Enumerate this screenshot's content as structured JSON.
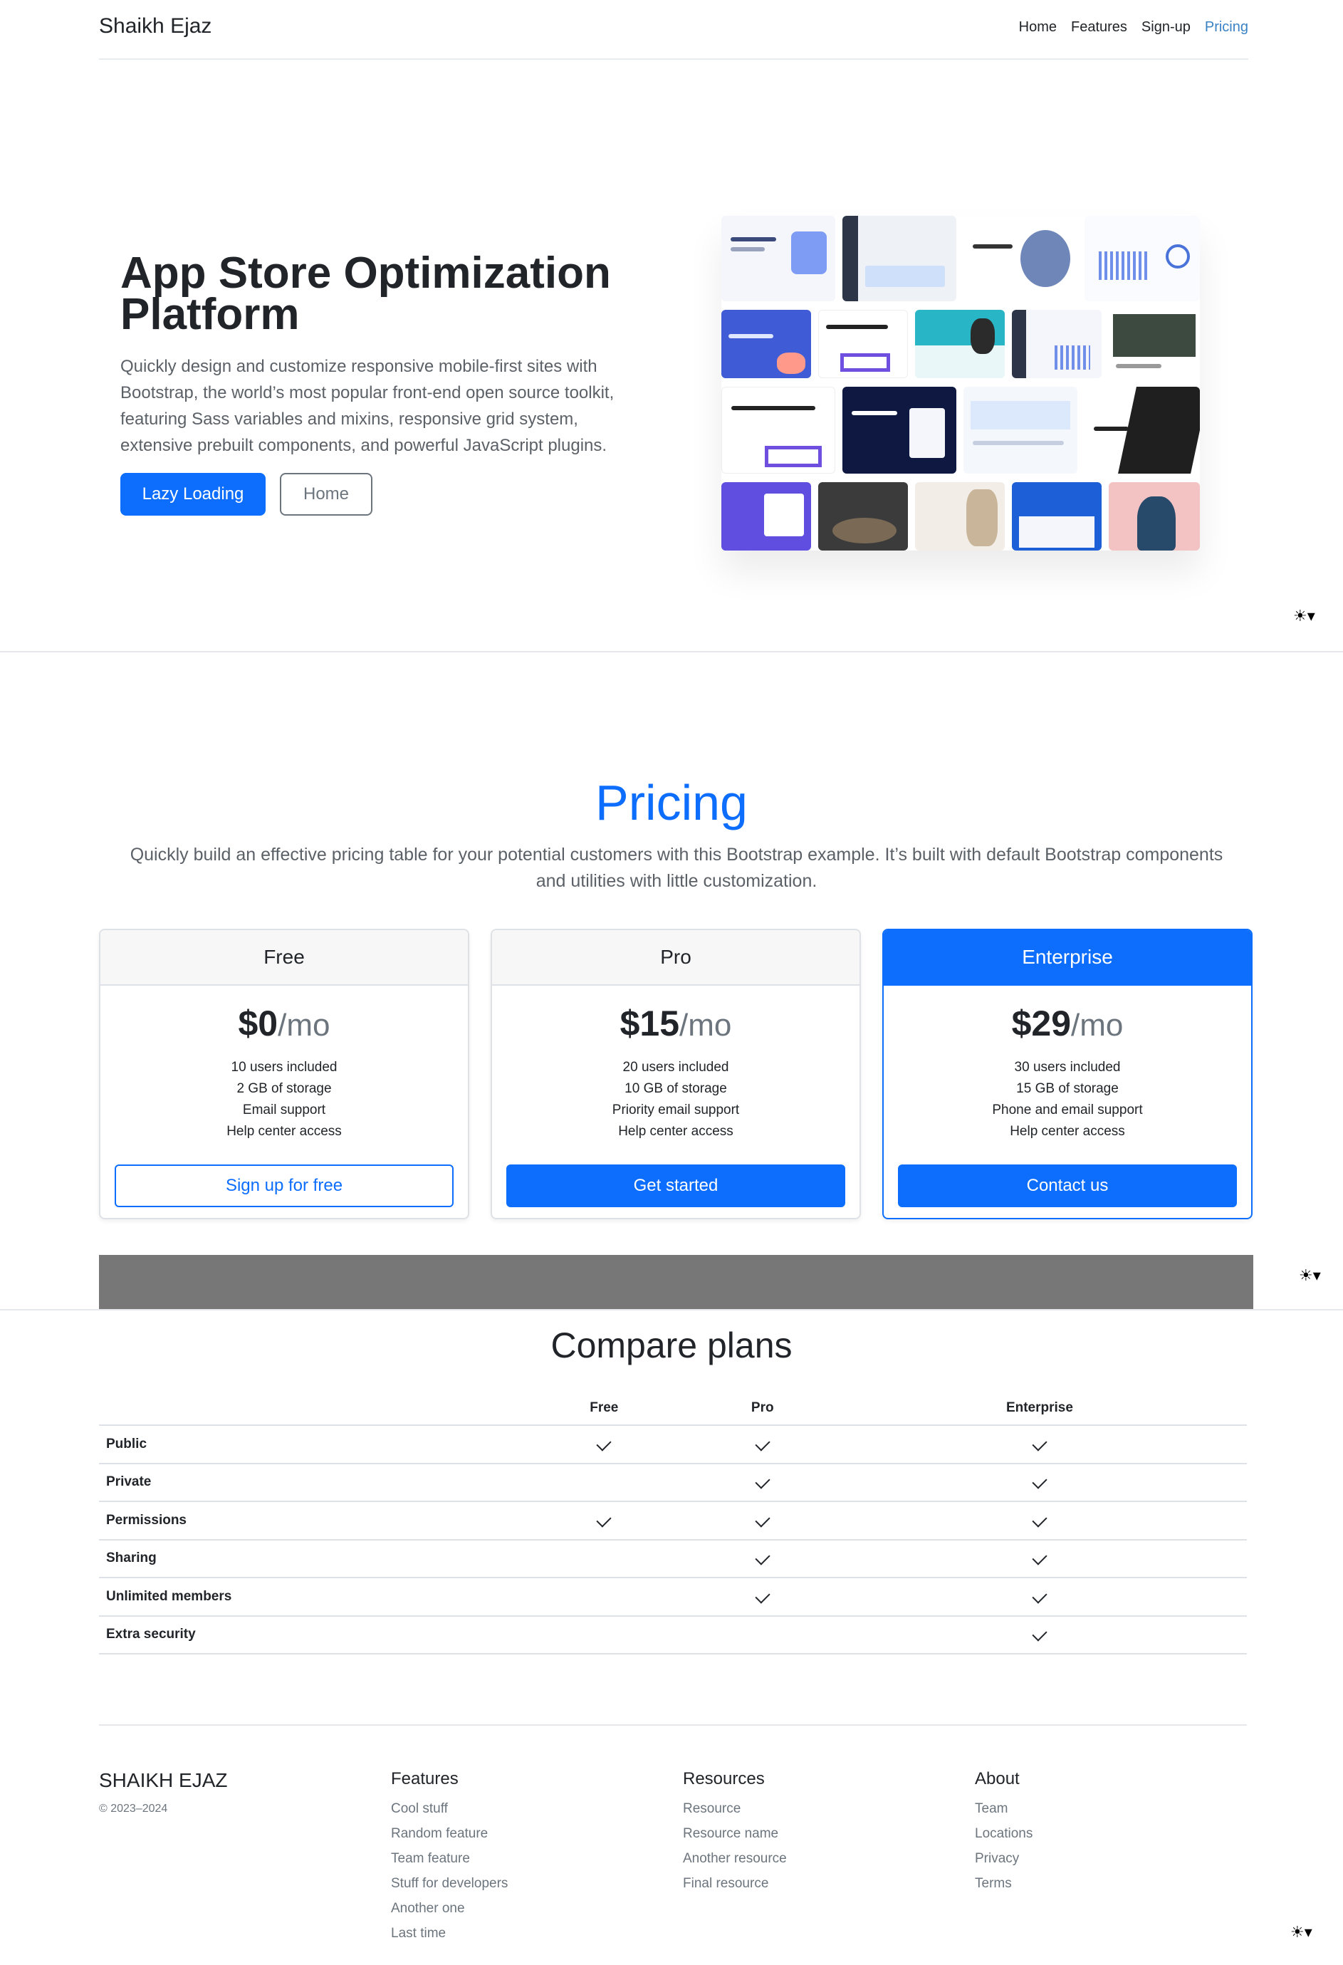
{
  "nav": {
    "brand": "Shaikh Ejaz",
    "links": [
      "Home",
      "Features",
      "Sign-up",
      "Pricing"
    ]
  },
  "hero": {
    "title": "App Store Optimization Platform",
    "text": "Quickly design and customize responsive mobile-first sites with Bootstrap, the world’s most popular front-end open source toolkit, featuring Sass variables and mixins, responsive grid system, extensive prebuilt components, and powerful JavaScript plugins.",
    "primary_button": "Lazy Loading",
    "secondary_button": "Home"
  },
  "theme_toggle": "☀▾",
  "pricing": {
    "title": "Pricing",
    "text": "Quickly build an effective pricing table for your potential customers with this Bootstrap example. It’s built with default Bootstrap components and utilities with little customization.",
    "per": "/mo",
    "plans": [
      {
        "name": "Free",
        "price": "$0",
        "features": [
          "10 users included",
          "2 GB of storage",
          "Email support",
          "Help center access"
        ],
        "button": "Sign up for free"
      },
      {
        "name": "Pro",
        "price": "$15",
        "features": [
          "20 users included",
          "10 GB of storage",
          "Priority email support",
          "Help center access"
        ],
        "button": "Get started"
      },
      {
        "name": "Enterprise",
        "price": "$29",
        "features": [
          "30 users included",
          "15 GB of storage",
          "Phone and email support",
          "Help center access"
        ],
        "button": "Contact us"
      }
    ]
  },
  "compare": {
    "title": "Compare plans",
    "columns": [
      "Free",
      "Pro",
      "Enterprise"
    ],
    "rows": [
      {
        "label": "Public",
        "checks": [
          true,
          true,
          true
        ]
      },
      {
        "label": "Private",
        "checks": [
          false,
          true,
          true
        ]
      },
      {
        "label": "Permissions",
        "checks": [
          true,
          true,
          true
        ]
      },
      {
        "label": "Sharing",
        "checks": [
          false,
          true,
          true
        ]
      },
      {
        "label": "Unlimited members",
        "checks": [
          false,
          true,
          true
        ]
      },
      {
        "label": "Extra security",
        "checks": [
          false,
          false,
          true
        ]
      }
    ]
  },
  "footer": {
    "brand": "SHAIKH EJAZ",
    "copyright": "© 2023–2024",
    "columns": [
      {
        "title": "Features",
        "items": [
          "Cool stuff",
          "Random feature",
          "Team feature",
          "Stuff for developers",
          "Another one",
          "Last time"
        ]
      },
      {
        "title": "Resources",
        "items": [
          "Resource",
          "Resource name",
          "Another resource",
          "Final resource"
        ]
      },
      {
        "title": "About",
        "items": [
          "Team",
          "Locations",
          "Privacy",
          "Terms"
        ]
      }
    ]
  },
  "colors": {
    "primary": "#0d6efd",
    "muted": "#6c757d",
    "gray_block": "#777777"
  }
}
